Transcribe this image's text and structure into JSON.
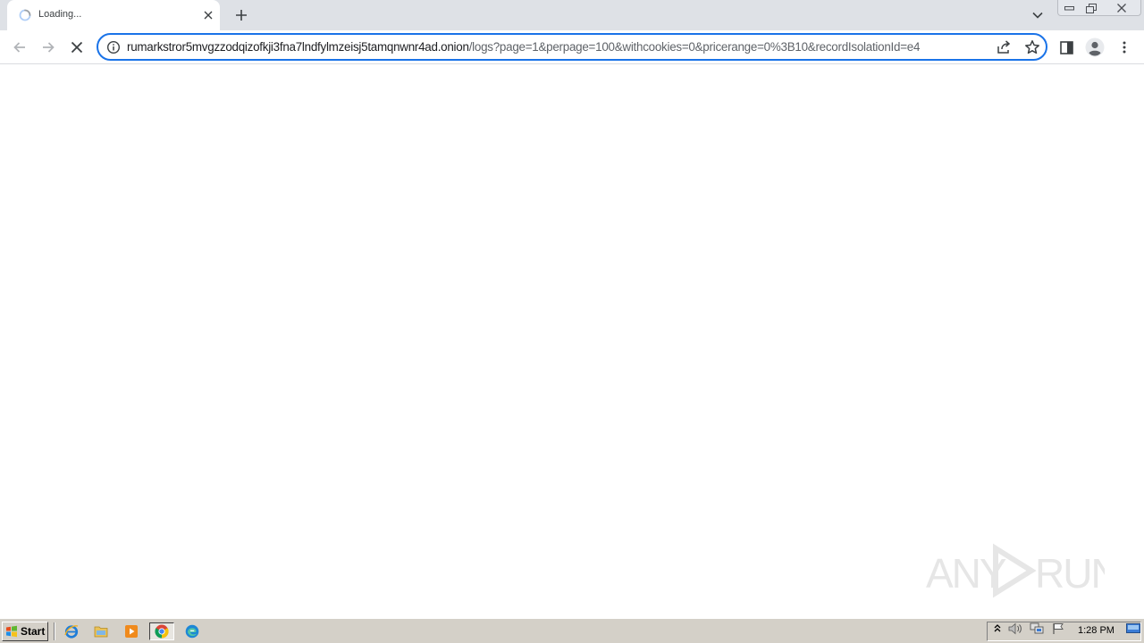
{
  "browser": {
    "tab": {
      "title": "Loading...",
      "icon": "loading-spinner-icon"
    },
    "new_tab_icon": "plus-icon",
    "tab_search_icon": "chevron-down-icon",
    "window_controls": [
      "minimize-icon",
      "restore-icon",
      "close-icon"
    ]
  },
  "toolbar": {
    "back_icon": "arrow-left-icon",
    "forward_icon": "arrow-right-icon",
    "stop_icon": "stop-x-icon",
    "url_host": "rumarkstror5mvgzzodqizofkji3fna7lndfylmzeisj5tamqnwnr4ad.onion",
    "url_path": "/logs?page=1&perpage=100&withcookies=0&pricerange=0%3B10&recordIsolationId=e4",
    "info_icon": "info-icon",
    "share_icon": "share-icon",
    "bookmark_icon": "star-icon",
    "side_panel_icon": "side-panel-icon",
    "profile_icon": "avatar-icon",
    "menu_icon": "kebab-menu-icon"
  },
  "page": {
    "watermark": "ANY RUN"
  },
  "taskbar": {
    "start_label": "Start",
    "quick_launch": [
      "internet-explorer-icon",
      "folder-icon",
      "media-player-icon",
      "chrome-icon",
      "edge-icon"
    ],
    "tray": [
      "tray-expand-icon",
      "volume-icon",
      "network-icon",
      "flag-icon"
    ],
    "clock": "1:28 PM",
    "show_desktop_icon": "show-desktop-icon"
  },
  "colors": {
    "accent": "#1a73e8",
    "tabstrip": "#dee1e6",
    "taskbar": "#d4d0c8"
  }
}
